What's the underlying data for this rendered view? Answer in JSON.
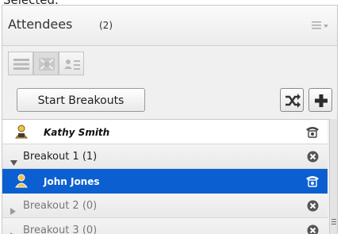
{
  "top_clip_text": "Selected.",
  "header": {
    "title": "Attendees",
    "count": "(2)",
    "menu_icon": "hamburger-menu-icon"
  },
  "view_toolbar": {
    "buttons": [
      {
        "icon": "list-view-icon"
      },
      {
        "icon": "grid-view-icon",
        "active": true
      },
      {
        "icon": "card-view-icon"
      }
    ]
  },
  "actions": {
    "start_breakouts_label": "Start Breakouts",
    "shuffle_icon": "shuffle-icon",
    "add_icon": "plus-icon"
  },
  "attendees_list": {
    "rows": [
      {
        "type": "attendee",
        "name": "Kathy Smith",
        "icon": "host-user-icon",
        "status_icon": "phone-icon"
      },
      {
        "type": "breakout",
        "label": "Breakout 1 (1)",
        "expanded": true,
        "action_icon": "remove-icon"
      },
      {
        "type": "attendee",
        "name": "John Jones",
        "selected": true,
        "icon": "user-icon",
        "status_icon": "phone-icon"
      },
      {
        "type": "breakout",
        "label": "Breakout 2 (0)",
        "expanded": false,
        "action_icon": "remove-icon"
      },
      {
        "type": "breakout",
        "label": "Breakout 3 (0)",
        "expanded": false,
        "action_icon": "remove-icon"
      }
    ]
  },
  "colors": {
    "selected_row": "#0b5fd0",
    "panel_bg": "#f0f0f0",
    "header_text": "#333333"
  }
}
